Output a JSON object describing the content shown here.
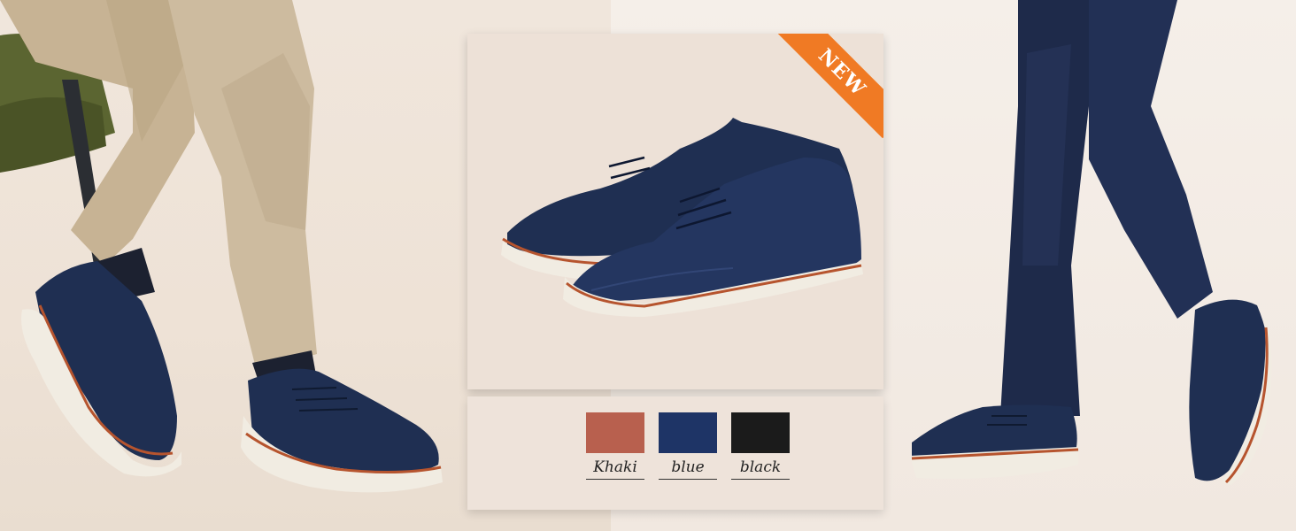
{
  "badge": {
    "text": "NEW",
    "color": "#f07a24"
  },
  "colors": [
    {
      "name": "Khaki",
      "hex": "#b8604e"
    },
    {
      "name": "blue",
      "hex": "#1e3466"
    },
    {
      "name": "black",
      "hex": "#1b1b1b"
    }
  ],
  "palette": {
    "shoe_navy": "#1f2f52",
    "sole_white": "#f1ece2",
    "welt_brown": "#b6542e",
    "pants_khaki": "#cbb89d",
    "pants_navy": "#1e2a4a"
  }
}
